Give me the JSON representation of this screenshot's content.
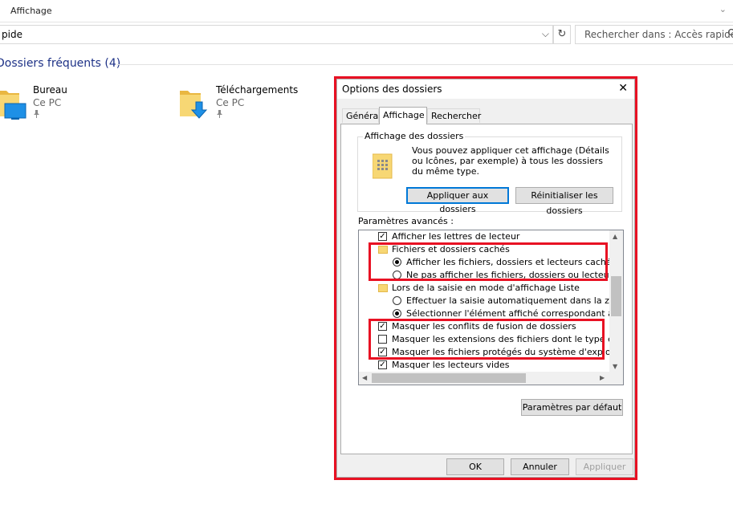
{
  "explorer": {
    "ribbon_title": "Affichage",
    "ribbon_chevron": "⌄",
    "address": "pide",
    "address_dropdown": "⌵",
    "refresh": "↻",
    "search_placeholder": "Rechercher dans : Accès rapide",
    "search_icon": "search-icon",
    "section_title": "Dossiers fréquents (4)",
    "items": [
      {
        "name": "Bureau",
        "location": "Ce PC",
        "pin": "📌",
        "icon": "desktop-folder-icon"
      },
      {
        "name": "Téléchargements",
        "location": "Ce PC",
        "pin": "📌",
        "icon": "downloads-folder-icon"
      }
    ]
  },
  "dialog": {
    "title": "Options des dossiers",
    "close": "✕",
    "tabs": [
      {
        "label": "Général",
        "active": false
      },
      {
        "label": "Affichage",
        "active": true
      },
      {
        "label": "Rechercher",
        "active": false
      }
    ],
    "folder_view": {
      "group_label": "Affichage des dossiers",
      "description": "Vous pouvez appliquer cet affichage (Détails ou Icônes, par exemple) à tous les dossiers du même type.",
      "apply_button": "Appliquer aux dossiers",
      "reset_button": "Réinitialiser les dossiers"
    },
    "advanced_label": "Paramètres avancés :",
    "advanced_items": [
      {
        "kind": "checkbox",
        "checked": true,
        "label": "Afficher les lettres de lecteur"
      },
      {
        "kind": "folder",
        "label": "Fichiers et dossiers cachés"
      },
      {
        "kind": "radio",
        "checked": true,
        "label": "Afficher les fichiers, dossiers et lecteurs cachés"
      },
      {
        "kind": "radio",
        "checked": false,
        "label": "Ne pas afficher les fichiers, dossiers ou lecteurs cach"
      },
      {
        "kind": "folder",
        "label": "Lors de la saisie en mode d'affichage Liste"
      },
      {
        "kind": "radio",
        "checked": false,
        "label": "Effectuer la saisie automatiquement dans la zone Rec"
      },
      {
        "kind": "radio",
        "checked": true,
        "label": "Sélectionner l'élément affiché correspondant au texte"
      },
      {
        "kind": "checkbox",
        "checked": true,
        "label": "Masquer les conflits de fusion de dossiers"
      },
      {
        "kind": "checkbox",
        "checked": false,
        "label": "Masquer les extensions des fichiers dont le type est conn"
      },
      {
        "kind": "checkbox",
        "checked": true,
        "label": "Masquer les fichiers protégés du système d'exploitation (r"
      },
      {
        "kind": "checkbox",
        "checked": true,
        "label": "Masquer les lecteurs vides"
      }
    ],
    "scroll": {
      "up": "▲",
      "down": "▼",
      "left": "◀",
      "right": "▶"
    },
    "defaults_button": "Paramètres par défaut",
    "ok_button": "OK",
    "cancel_button": "Annuler",
    "apply_button": "Appliquer"
  },
  "colors": {
    "highlight_red": "#e81123",
    "focus_blue": "#0078d7",
    "section_blue": "#1e3287"
  }
}
